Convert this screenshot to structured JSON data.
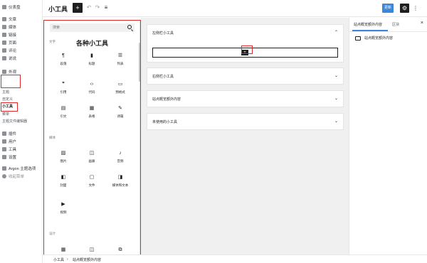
{
  "admin_menu": {
    "dashboard": "仪表盘",
    "posts": "文章",
    "media": "媒体",
    "links": "链接",
    "pages": "页面",
    "comments": "评论",
    "talk": "说说",
    "appearance": "外观",
    "appearance_sub": [
      "主题",
      "自定义",
      "小工具",
      "菜单",
      "主题文件编辑器"
    ],
    "plugins": "插件",
    "users": "用户",
    "tools": "工具",
    "settings": "设置",
    "argon_options": "Argon 主题选项",
    "collapse_menu": "收起菜单"
  },
  "toolbar": {
    "title": "小工具",
    "add_symbol": "+",
    "undo_symbol": "↶",
    "redo_symbol": "↷",
    "list_view_symbol": "≡",
    "update_label": "更新",
    "settings_symbol": "⚙",
    "more_symbol": "⋮"
  },
  "inserter": {
    "search_placeholder": "搜索",
    "heading": "各种小工具",
    "categories": {
      "text": "文字",
      "media": "媒体",
      "design": "设计"
    },
    "text_blocks": [
      {
        "label": "段落",
        "icon": "¶"
      },
      {
        "label": "标题",
        "icon": "▮"
      },
      {
        "label": "列表",
        "icon": "☰"
      },
      {
        "label": "引用",
        "icon": "❞"
      },
      {
        "label": "代码",
        "icon": "‹›"
      },
      {
        "label": "预格式",
        "icon": "▭"
      },
      {
        "label": "引文",
        "icon": "▤"
      },
      {
        "label": "表格",
        "icon": "▦"
      },
      {
        "label": "诗篇",
        "icon": "✎"
      }
    ],
    "media_blocks": [
      {
        "label": "图片",
        "icon": "▨"
      },
      {
        "label": "画廊",
        "icon": "◫"
      },
      {
        "label": "音频",
        "icon": "♪"
      },
      {
        "label": "封面",
        "icon": "◧"
      },
      {
        "label": "文件",
        "icon": "▢"
      },
      {
        "label": "媒体和文本",
        "icon": "◨"
      },
      {
        "label": "视频",
        "icon": "▶"
      }
    ],
    "design_icons": [
      "▦",
      "◫",
      "⧉"
    ]
  },
  "widget_areas": [
    {
      "title": "左侧栏小工具",
      "chevron": "⌃",
      "expanded": true,
      "add_symbol": "+"
    },
    {
      "title": "右侧栏小工具",
      "chevron": "⌄",
      "expanded": false
    },
    {
      "title": "站点概览额外内容",
      "chevron": "⌄",
      "expanded": false
    },
    {
      "title": "未使用的小工具",
      "chevron": "⌄",
      "expanded": false
    }
  ],
  "breadcrumb": {
    "root": "小工具",
    "separator": "›",
    "current": "站点概览额外内容"
  },
  "settings_panel": {
    "tab_area": "站点概览额外内容",
    "tab_block": "区块",
    "close_symbol": "×",
    "block_name": "站点概览额外内容"
  },
  "colors": {
    "accent": "#3a86d9",
    "highlight_box": "#e02a2a",
    "dark": "#1e1e1e"
  }
}
